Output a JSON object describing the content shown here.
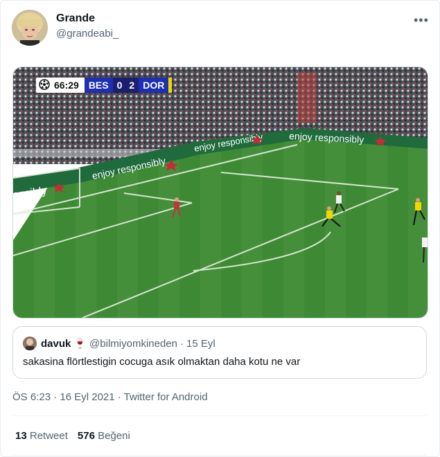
{
  "author": {
    "name": "Grande",
    "handle": "@grandeabi_"
  },
  "menu_icon": "more-dots-icon",
  "media": {
    "scoreboard": {
      "clock": "66:29",
      "home": "BES",
      "home_score": "0",
      "away_score": "2",
      "away": "DOR"
    },
    "ad_text": "enjoy responsibly",
    "ad_text_fragment": "onsibly"
  },
  "quote": {
    "name": "davuk",
    "emoji": "🍷",
    "handle": "@bilmiyomkineden",
    "separator": "·",
    "date": "15 Eyl",
    "text": "sakasina flörtlestigin cocuga asık olmaktan daha kotu ne var"
  },
  "meta": {
    "text": "ÖS 6:23 · 16 Eyl 2021 · Twitter for Android"
  },
  "stats": {
    "retweets_count": "13",
    "retweets_label": "Retweet",
    "likes_count": "576",
    "likes_label": "Beğeni"
  },
  "colors": {
    "pitch": "#3f8a35",
    "scoreboard_blue": "#1e2fb3",
    "accent_yellow": "#f2d600"
  }
}
